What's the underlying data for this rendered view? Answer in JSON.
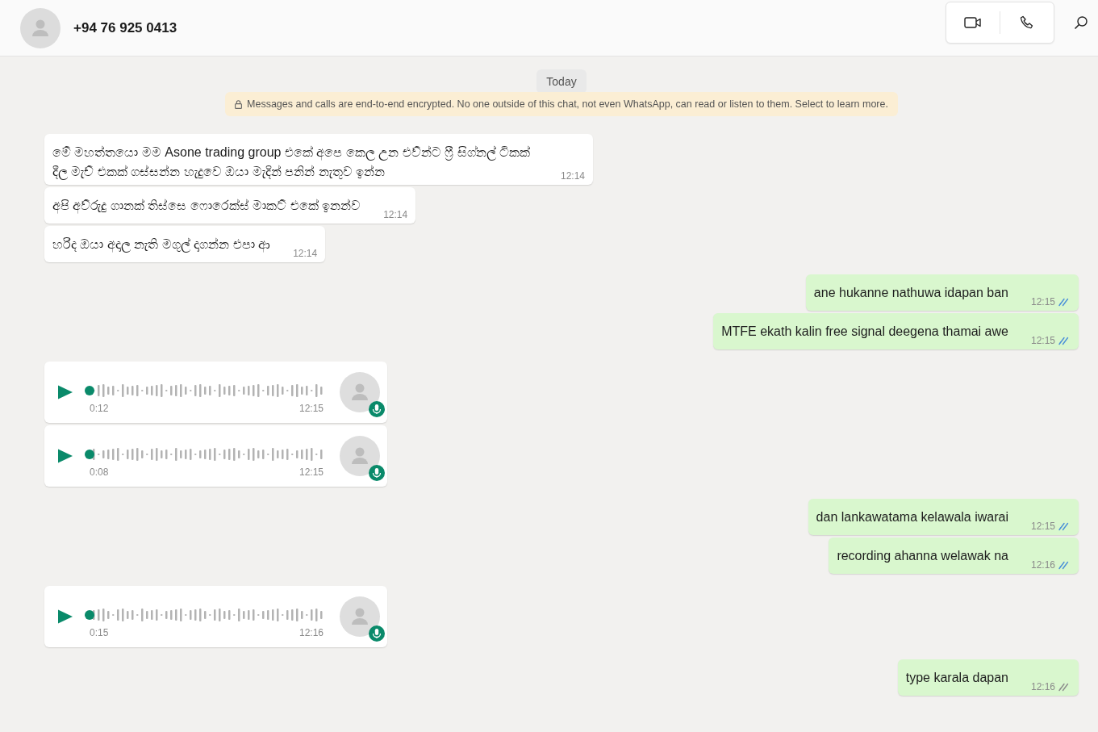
{
  "header": {
    "contact": "+94 76 925 0413"
  },
  "chat": {
    "date_chip": "Today",
    "encryption_notice": "Messages and calls are end-to-end encrypted. No one outside of this chat, not even WhatsApp, can read or listen to them. Select to learn more.",
    "messages": [
      {
        "kind": "text",
        "outgoing": false,
        "text": "මේ මහත්තයො මම  Asone trading group එකේ අපෙ කෙල උන එව්න්ට ෆ්‍රී සිග්නල් ටිකක් දීල මැච් එකක් ගස්සන්න හැදුවෙ ඔයා මැදින් පනින් නැතුව ඉන්න",
        "time": "12:14"
      },
      {
        "kind": "text",
        "outgoing": false,
        "text": "අපි අව්රුදු ගානක් තිස්සෙ ෆොරෙක්ස් මාකට් එකේ ඉනන්ව",
        "time": "12:14"
      },
      {
        "kind": "text",
        "outgoing": false,
        "text": "හරිද ඔයා අදාල නැති මගුල් දාගන්න එපා ආ",
        "time": "12:14"
      },
      {
        "kind": "text",
        "outgoing": true,
        "text": "ane hukanne nathuwa idapan ban",
        "time": "12:15",
        "read": true
      },
      {
        "kind": "text",
        "outgoing": true,
        "text": "MTFE ekath kalin free signal deegena thamai awe",
        "time": "12:15",
        "read": true
      },
      {
        "kind": "voice",
        "outgoing": false,
        "duration": "0:12",
        "time": "12:15"
      },
      {
        "kind": "voice",
        "outgoing": false,
        "duration": "0:08",
        "time": "12:15"
      },
      {
        "kind": "text",
        "outgoing": true,
        "text": "dan lankawatama kelawala iwarai",
        "time": "12:15",
        "read": true
      },
      {
        "kind": "text",
        "outgoing": true,
        "text": "recording ahanna welawak na",
        "time": "12:16",
        "read": true
      },
      {
        "kind": "voice",
        "outgoing": false,
        "duration": "0:15",
        "time": "12:16"
      },
      {
        "kind": "text",
        "outgoing": true,
        "text": "type karala dapan",
        "time": "12:16",
        "read": false
      }
    ]
  }
}
